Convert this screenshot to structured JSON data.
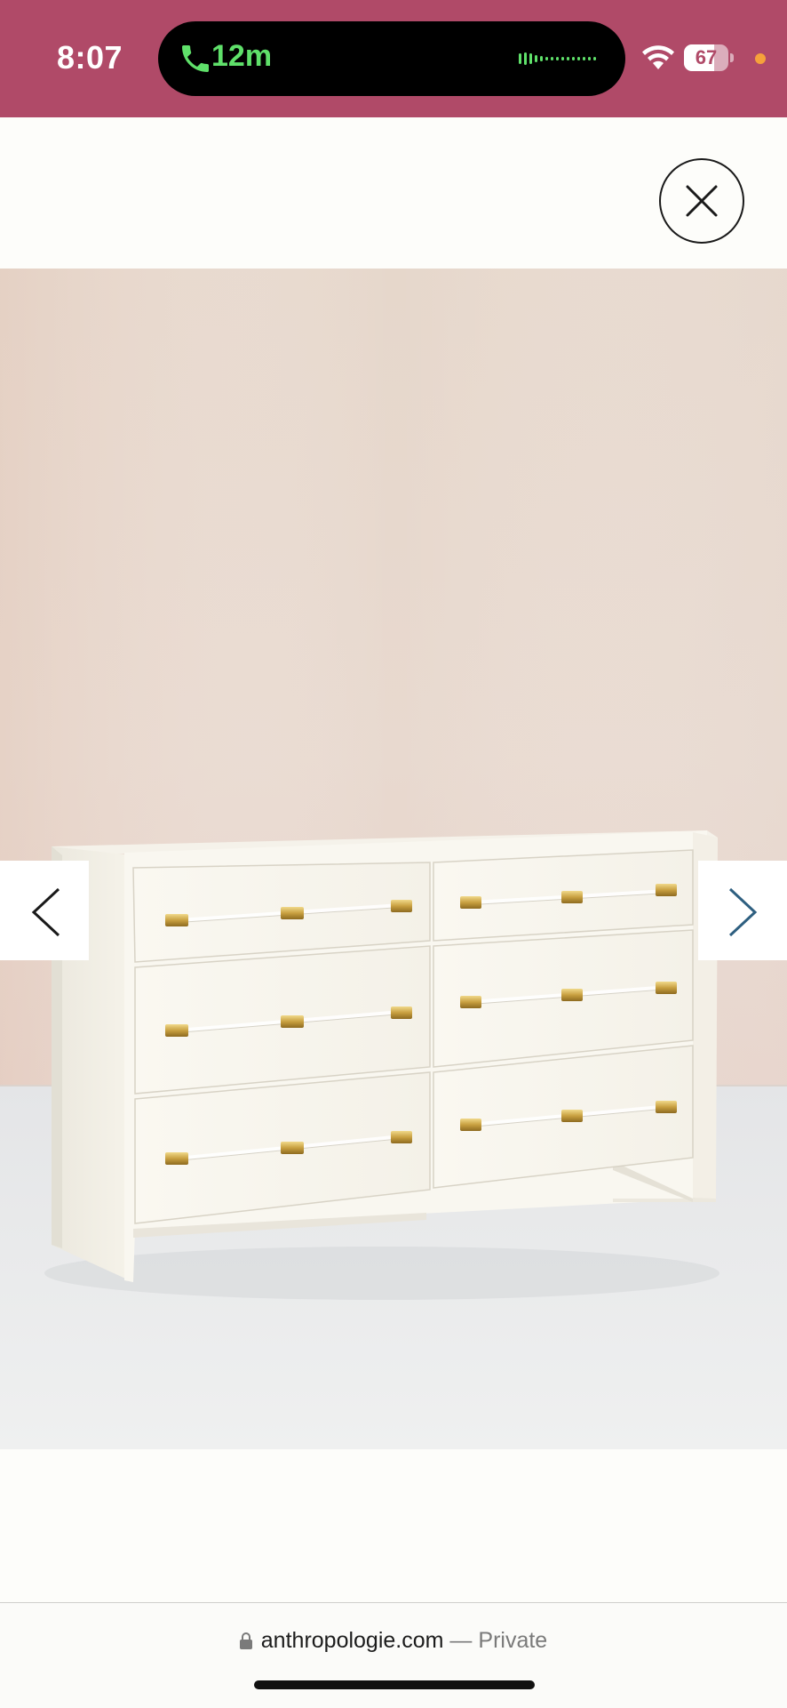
{
  "status_bar": {
    "time": "8:07",
    "call_duration": "12m",
    "battery_percent": "67",
    "battery_level": 0.67,
    "icons": [
      "phone-icon",
      "waveform-icon",
      "wifi-icon",
      "battery-icon",
      "privacy-indicator-dot"
    ],
    "background_color": "#b04a68",
    "call_text_color": "#5fe06a"
  },
  "modal": {
    "close_icon": "close-icon"
  },
  "gallery": {
    "product_image": "white-six-drawer-dresser-with-lucite-handles",
    "prev_icon": "chevron-left-icon",
    "next_icon": "chevron-right-icon"
  },
  "browser": {
    "lock_icon": "lock-icon",
    "domain": "anthropologie.com",
    "separator": " — ",
    "mode": "Private"
  }
}
